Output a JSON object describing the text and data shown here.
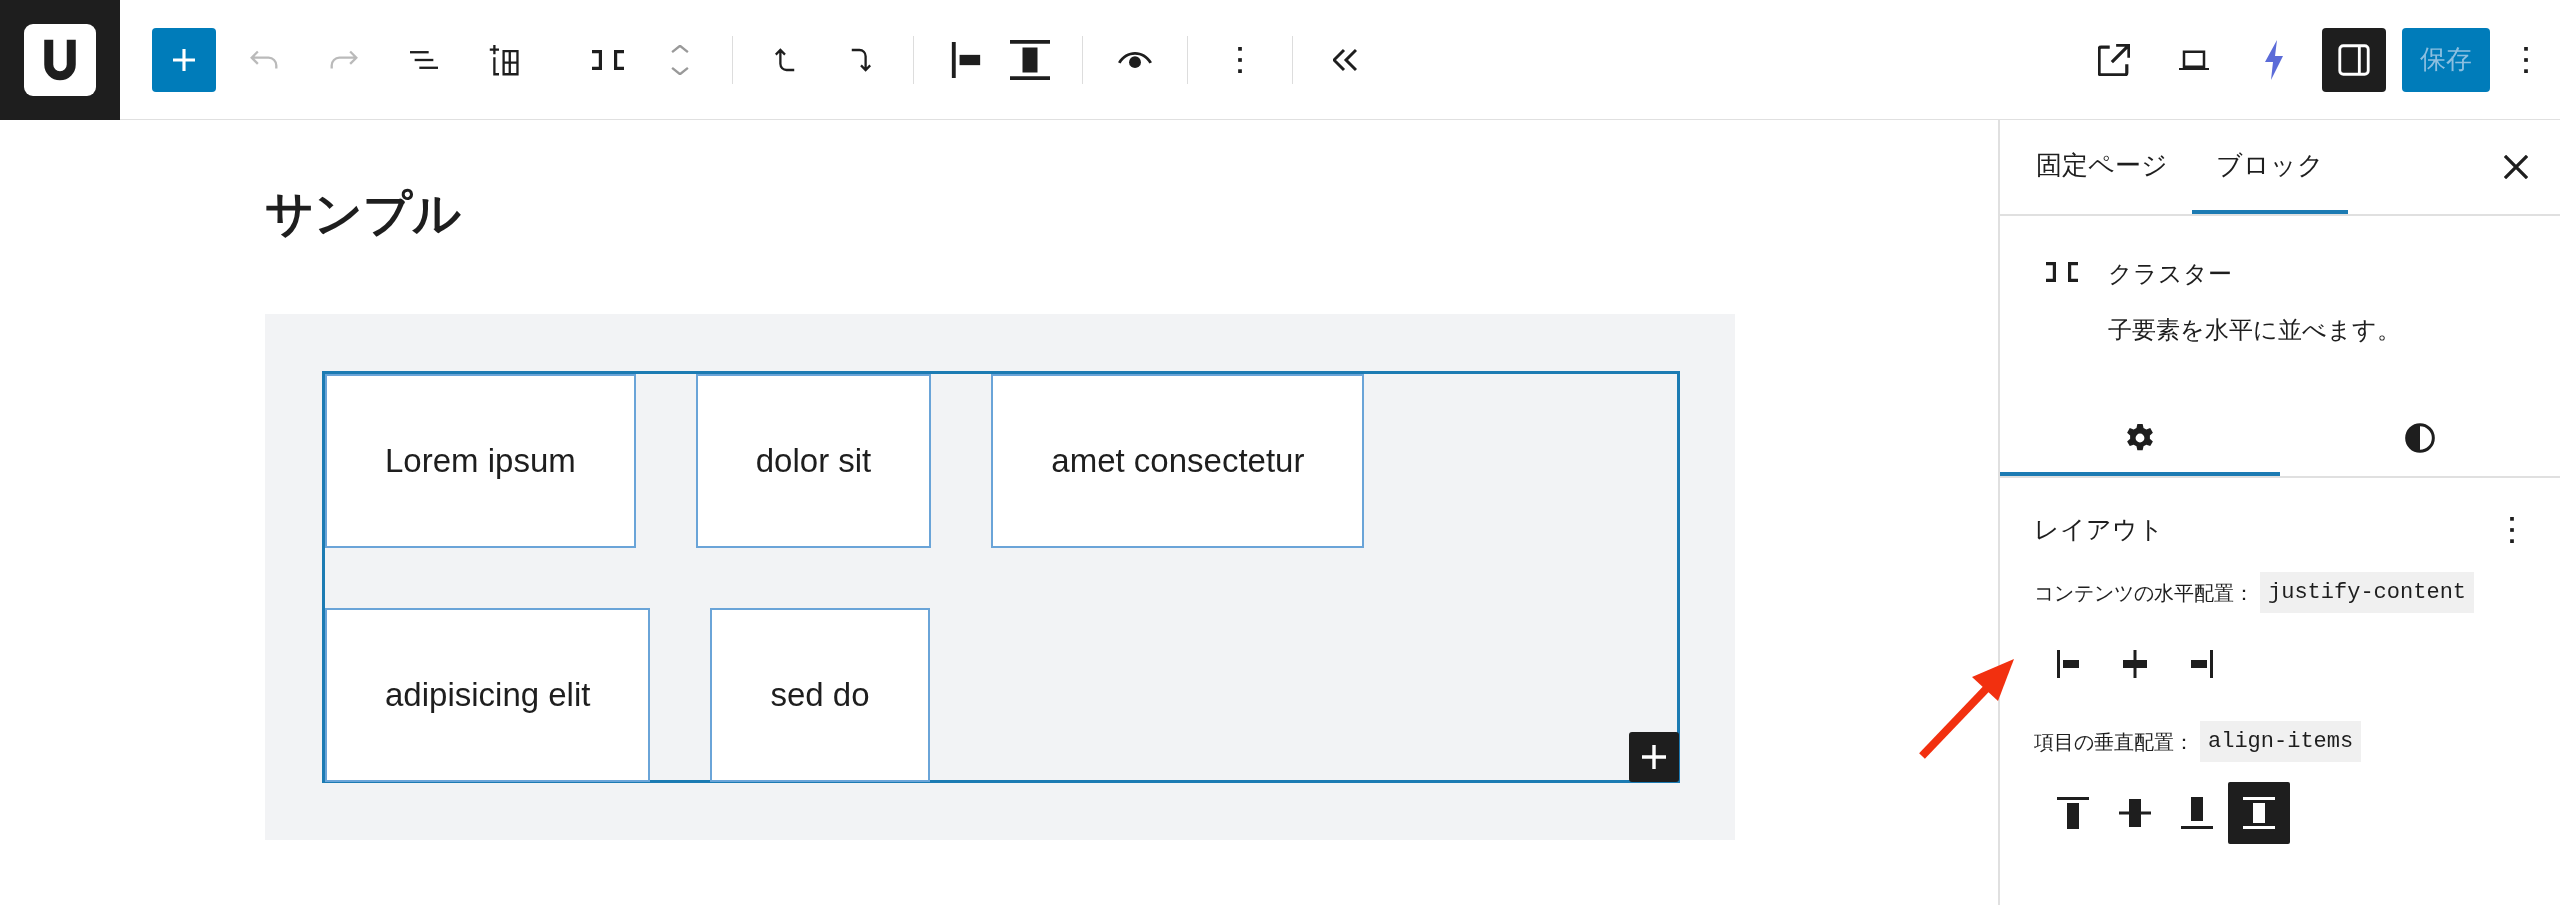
{
  "toolbar": {
    "undo": {
      "disabled": true
    },
    "redo": {
      "disabled": true
    },
    "settings_toggle": {
      "pressed": true
    },
    "save_button": {
      "label": "保存",
      "disabled": true
    }
  },
  "editor": {
    "title": "サンプル",
    "cluster_items": [
      "Lorem ipsum",
      "dolor sit",
      "amet consectetur",
      "adipisicing elit",
      "sed do"
    ]
  },
  "sidebar": {
    "tabs": [
      {
        "label": "固定ページ",
        "selected": false
      },
      {
        "label": "ブロック",
        "selected": true
      }
    ],
    "block": {
      "name": "クラスター",
      "description": "子要素を水平に並べます。"
    },
    "panel_tabs": [
      {
        "kind": "settings",
        "selected": true
      },
      {
        "kind": "styles",
        "selected": false
      }
    ],
    "layout": {
      "title": "レイアウト",
      "justify": {
        "label": "コンテンツの水平配置：",
        "code": "justify-content",
        "options": [
          {
            "kind": "left",
            "selected": false
          },
          {
            "kind": "center",
            "selected": false
          },
          {
            "kind": "right",
            "selected": false
          }
        ]
      },
      "align": {
        "label": "項目の垂直配置：",
        "code": "align-items",
        "options": [
          {
            "kind": "top",
            "selected": false
          },
          {
            "kind": "center",
            "selected": false
          },
          {
            "kind": "bottom",
            "selected": false
          },
          {
            "kind": "stretch",
            "selected": true
          }
        ]
      }
    }
  }
}
